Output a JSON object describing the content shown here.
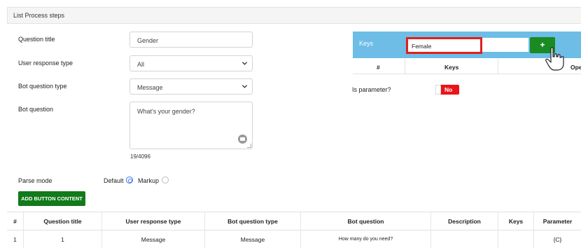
{
  "header": {
    "title": "List Process steps"
  },
  "form": {
    "question_title": {
      "label": "Question title",
      "value": "Gender"
    },
    "user_response_type": {
      "label": "User response type",
      "value": "All"
    },
    "bot_question_type": {
      "label": "Bot question type",
      "value": "Message"
    },
    "bot_question": {
      "label": "Bot question",
      "value": "What's your gender?",
      "counter": "19/4096"
    },
    "parse_mode": {
      "label": "Parse mode",
      "options": [
        "Default",
        "Markup"
      ],
      "selected": "Default"
    },
    "add_button_label": "ADD BUTTON CONTENT"
  },
  "keys": {
    "label": "Keys",
    "input_value": "Female",
    "add_icon": "plus-icon",
    "columns": [
      "#",
      "Keys",
      "Ope"
    ]
  },
  "is_parameter": {
    "label": "Is parameter?",
    "toggle_text": "No",
    "state": false
  },
  "table": {
    "columns": [
      "#",
      "Question title",
      "User response type",
      "Bot question type",
      "Bot question",
      "Description",
      "Keys",
      "Parameter"
    ],
    "rows": [
      [
        "1",
        "1",
        "Message",
        "Message",
        "How many do you need?",
        "",
        "",
        "{C}"
      ]
    ]
  },
  "colors": {
    "keys_panel": "#6dbde7",
    "green_button": "#117a1a",
    "highlight_border": "#e0201c",
    "toggle_off": "#e8141a"
  }
}
